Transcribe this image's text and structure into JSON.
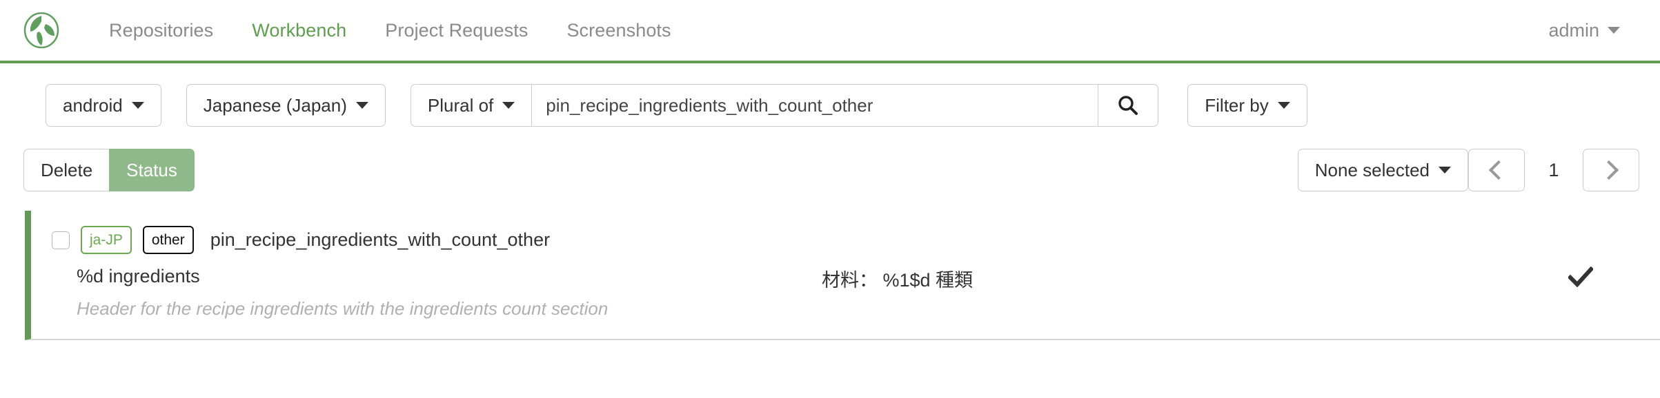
{
  "navbar": {
    "logo_name": "leaf-globe-logo",
    "links": [
      {
        "label": "Repositories",
        "active": false
      },
      {
        "label": "Workbench",
        "active": true
      },
      {
        "label": "Project Requests",
        "active": false
      },
      {
        "label": "Screenshots",
        "active": false
      }
    ],
    "user": "admin",
    "accent_color": "#639a55",
    "active_link_color": "#5e9e4f",
    "inactive_link_color": "#8a8a8a"
  },
  "toolbar": {
    "repository_filter": "android",
    "locale_filter": "Japanese (Japan)",
    "search_scope": "Plural of",
    "search_value": "pin_recipe_ingredients_with_count_other",
    "search_placeholder": "Search",
    "search_icon": "magnifier-icon",
    "filter_by": "Filter by"
  },
  "actionbar": {
    "delete_label": "Delete",
    "status_label": "Status",
    "status_button_color": "#8fb98a",
    "selection_label": "None selected",
    "prev_label": "‹",
    "page_number": "1",
    "next_label": "›"
  },
  "results": [
    {
      "locale_badge": "ja-JP",
      "plural_badge": "other",
      "key": "pin_recipe_ingredients_with_count_other",
      "source_text": "%d ingredients",
      "comment": "Header for the recipe ingredients with the ingredients count section",
      "translation": "材料： %1$d 種類",
      "status_icon": "check-icon",
      "accent_color": "#639a55"
    }
  ]
}
